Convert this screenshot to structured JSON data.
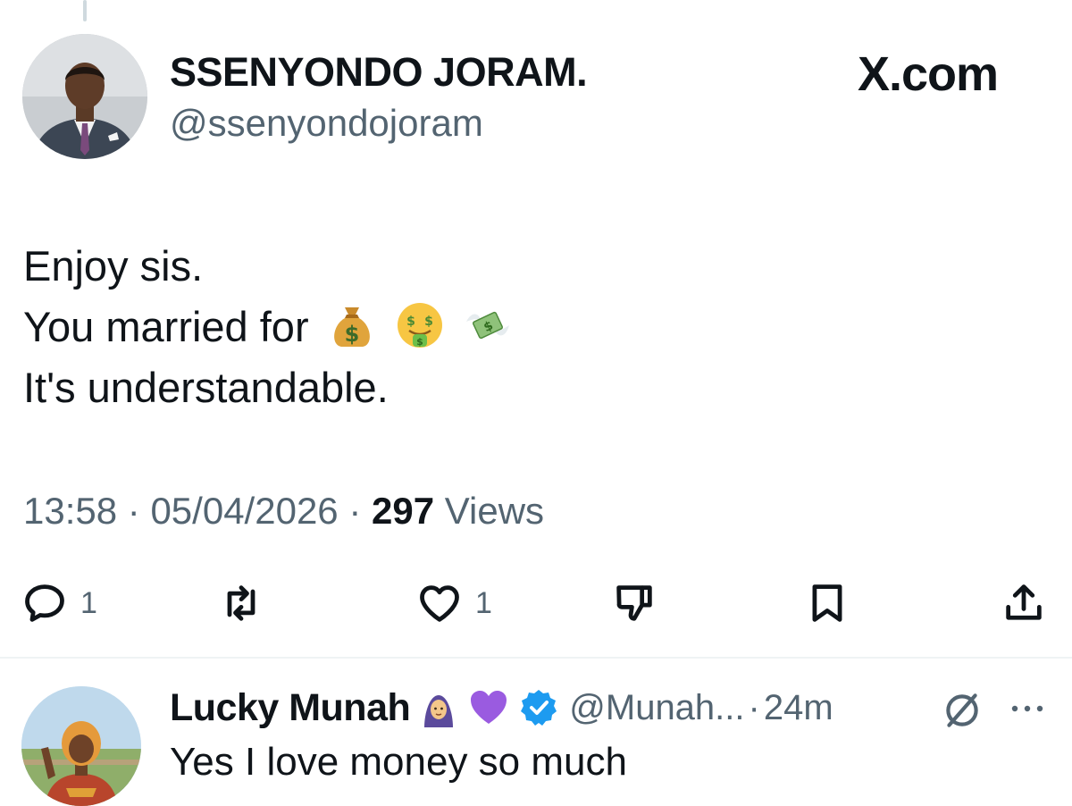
{
  "post": {
    "author": {
      "name": "SSENYONDO JORAM.",
      "handle": "@ssenyondojoram"
    },
    "brand": "X.com",
    "text_lines": [
      "Enjoy sis.",
      "You married for",
      "It's understandable."
    ],
    "emojis": [
      "money-bag",
      "money-mouth-face",
      "money-with-wings"
    ],
    "time": "13:58",
    "separator": "·",
    "date": "05/04/2026",
    "views_count": "297",
    "views_label": "Views",
    "actions": {
      "reply_count": "1",
      "retweet_count": "",
      "like_count": "1"
    }
  },
  "reply": {
    "name": "Lucky Munah",
    "badges": [
      "woman-with-headscarf",
      "purple-heart",
      "verified-badge"
    ],
    "handle": "@Munah...",
    "separator": "·",
    "time": "24m",
    "text": "Yes I love money so much"
  },
  "colors": {
    "text_primary": "#0f1419",
    "text_secondary": "#536471",
    "divider": "#eff3f4",
    "verified": "#1d9bf0"
  }
}
